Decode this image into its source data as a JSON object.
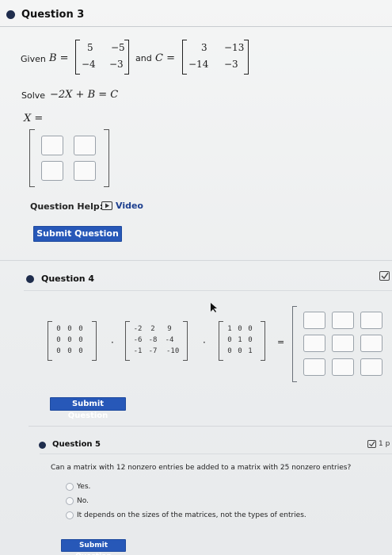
{
  "q3": {
    "title": "Question 3",
    "given_prefix": "Given",
    "B_label": "B =",
    "B": [
      [
        "5",
        "−5"
      ],
      [
        "−4",
        "−3"
      ]
    ],
    "and_text": "and",
    "C_label": "C =",
    "C": [
      [
        "3",
        "−13"
      ],
      [
        "−14",
        "−3"
      ]
    ],
    "solve_prefix": "Solve",
    "equation": "−2X + B = C",
    "x_label": "X =",
    "help_label": "Question Help:",
    "video_label": "Video",
    "submit_label": "Submit Question"
  },
  "q4": {
    "title": "Question 4",
    "m1": [
      [
        "0",
        "0",
        "0"
      ],
      [
        "0",
        "0",
        "0"
      ],
      [
        "0",
        "0",
        "0"
      ]
    ],
    "m2": [
      [
        "-2",
        "2",
        "9"
      ],
      [
        "-6",
        "-8",
        "-4"
      ],
      [
        "-1",
        "-7",
        "-10"
      ]
    ],
    "m3": [
      [
        "1",
        "0",
        "0"
      ],
      [
        "0",
        "1",
        "0"
      ],
      [
        "0",
        "0",
        "1"
      ]
    ],
    "dot1": "·",
    "dot2": "·",
    "equals": "=",
    "submit_label": "Submit Question"
  },
  "q5": {
    "title": "Question 5",
    "points_fragment": "1 p",
    "prompt": "Can a matrix with 12 nonzero entries be added to a matrix with 25 nonzero entries?",
    "options": [
      "Yes.",
      "No.",
      "It depends on the sizes of the matrices, not the types of entries."
    ],
    "submit_label": "Submit Question"
  }
}
